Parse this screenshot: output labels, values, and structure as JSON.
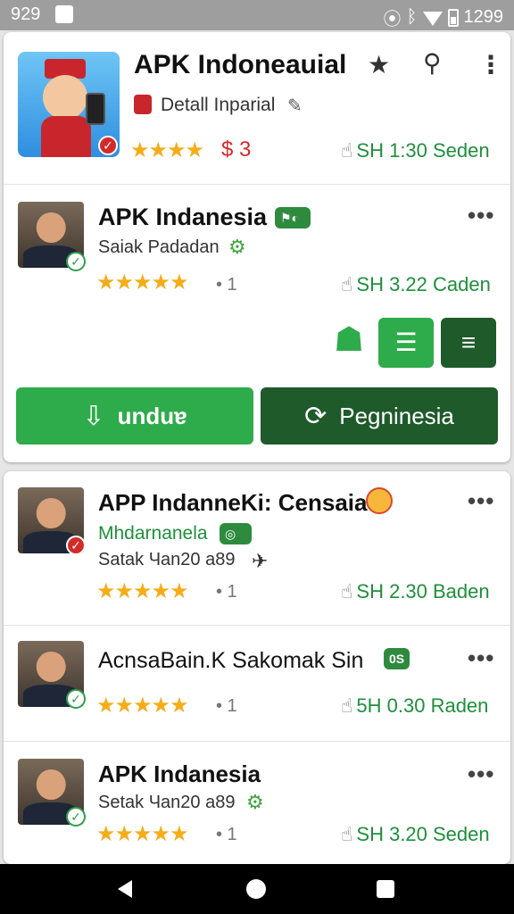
{
  "status_bar": {
    "time": "929",
    "right_text": "1299"
  },
  "header_app": {
    "title": "APK Indoneauial",
    "subtitle": "Detall Inparial",
    "rating_stars": "★★★★",
    "price": "$ 3",
    "meta": "SH 1:30 Seden",
    "icons": [
      "star-icon",
      "search-icon",
      "more-vert-icon"
    ]
  },
  "featured_app": {
    "title": "APK Indanesia",
    "subtitle": "Saiak Padadan",
    "rating_stars": "★★★★★",
    "count": "• 1",
    "meta": "SH 3.22 Caden",
    "more": "•••",
    "download_button": "unduɐ",
    "secondary_button": "Pegninesia"
  },
  "list": [
    {
      "title": "APP IndanneKi: Censaia",
      "subtitle": "Mhdarnanela",
      "subtitle2": "Satak Чan20 a89",
      "rating_stars": "★★★★★",
      "count": "• 1",
      "meta": "SH 2.30 Baden",
      "more": "•••"
    },
    {
      "title": "AcnsaBain.K Sakomak Sin",
      "badge": "0S",
      "rating_stars": "★★★★★",
      "count": "• 1",
      "meta": "5H 0.30 Raden",
      "more": "•••"
    },
    {
      "title": "APK Indanesia",
      "subtitle": "Setak Чan20 a89",
      "rating_stars": "★★★★★",
      "count": "• 1",
      "meta": "SH 3.20 Seden",
      "more": "•••"
    }
  ],
  "colors": {
    "primary_green": "#2eab4a",
    "dark_green": "#1f5a2b",
    "star": "#f4ad19",
    "status_bar": "#9e9e9e"
  }
}
